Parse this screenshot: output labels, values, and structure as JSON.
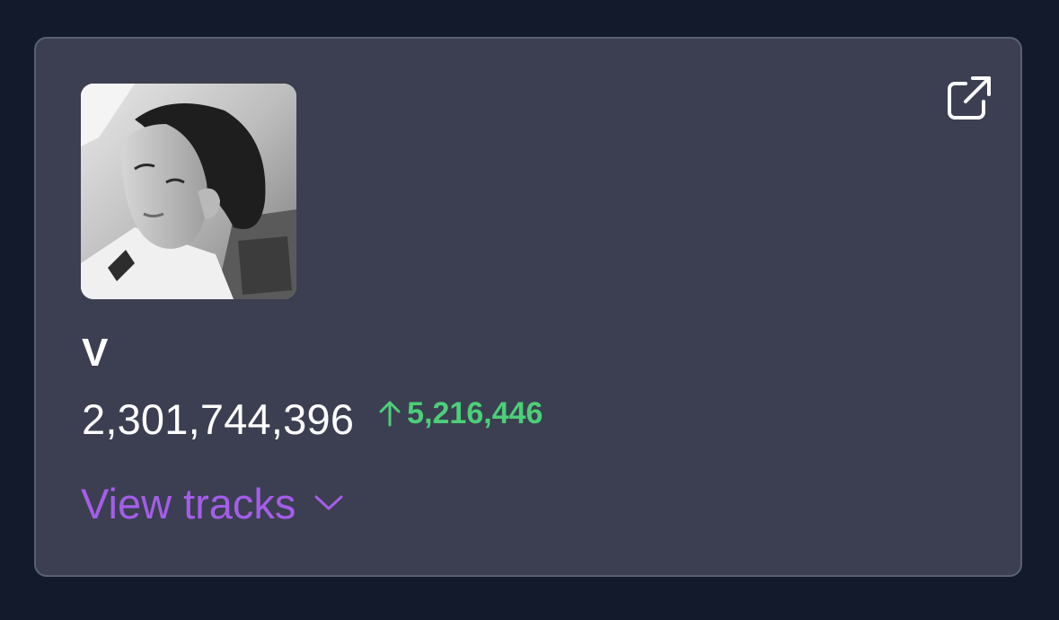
{
  "card": {
    "artist_name": "V",
    "total_streams": "2,301,744,396",
    "daily_gain": "5,216,446",
    "view_tracks_label": "View tracks",
    "icons": {
      "external_link": "external-link-icon",
      "delta_arrow": "arrow-up-icon",
      "chevron": "chevron-down-icon"
    },
    "colors": {
      "background": "#131a2b",
      "card_background": "#3b3f51",
      "card_border": "#5b6072",
      "gain_green": "#4ccf78",
      "link_purple": "#a45ee8",
      "text_white": "#ffffff"
    }
  }
}
